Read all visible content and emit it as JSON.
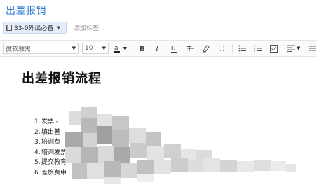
{
  "note": {
    "title": "出差报销"
  },
  "tags": {
    "notebook_label": "33-0外出必备",
    "add_tag_placeholder": "添加标签..."
  },
  "toolbar": {
    "font_family": "微软雅黑",
    "font_size": "10",
    "icons": [
      "font-color-icon",
      "bold-icon",
      "italic-icon",
      "underline-icon",
      "strikethrough-icon",
      "highlight-icon",
      "code-icon",
      "bullet-list-icon",
      "numbered-list-icon",
      "checkbox-list-icon",
      "align-icon"
    ]
  },
  "document": {
    "heading": "出差报销流程",
    "steps": [
      {
        "num": "1.",
        "text": "发票 - "
      },
      {
        "num": "2.",
        "text": "填出差"
      },
      {
        "num": "3.",
        "text": "培训费"
      },
      {
        "num": "4.",
        "text": "培训发票"
      },
      {
        "num": "5.",
        "text": "提交教育"
      },
      {
        "num": "6.",
        "text": "差旅费申"
      }
    ]
  },
  "colors": {
    "accent": "#2e7bd6",
    "tag_bg": "#e3ecf8"
  }
}
